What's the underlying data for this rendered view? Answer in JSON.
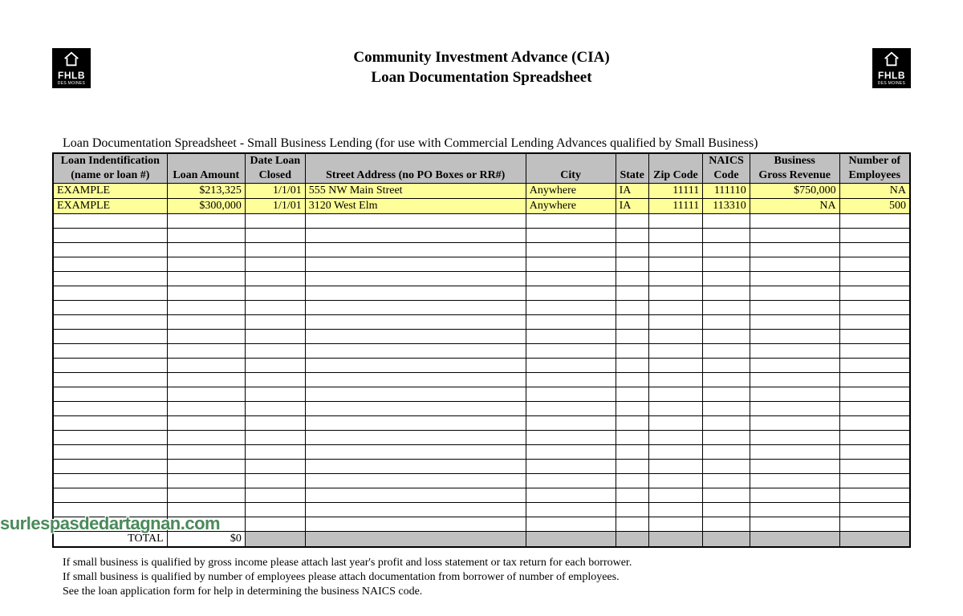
{
  "logo": {
    "line1": "FHLB",
    "line2": "DES MOINES"
  },
  "header": {
    "title1": "Community Investment Advance (CIA)",
    "title2": "Loan Documentation Spreadsheet"
  },
  "subtitle": "Loan Documentation Spreadsheet - Small Business Lending (for use with Commercial Lending Advances qualified by Small Business)",
  "columns": {
    "loan_id_1": "Loan Indentification",
    "loan_id_2": "(name or loan #)",
    "amount": "Loan Amount",
    "date_1": "Date Loan",
    "date_2": "Closed",
    "street": "Street Address (no PO Boxes or RR#)",
    "city": "City",
    "state": "State",
    "zip": "Zip Code",
    "naics_1": "NAICS",
    "naics_2": "Code",
    "revenue_1": "Business",
    "revenue_2": "Gross Revenue",
    "emp_1": "Number of",
    "emp_2": "Employees"
  },
  "rows": [
    {
      "loan_id": "EXAMPLE",
      "amount": "$213,325",
      "date": "1/1/01",
      "street": "555 NW Main Street",
      "city": "Anywhere",
      "state": "IA",
      "zip": "11111",
      "naics": "111110",
      "revenue": "$750,000",
      "emp": "NA"
    },
    {
      "loan_id": "EXAMPLE",
      "amount": "$300,000",
      "date": "1/1/01",
      "street": "3120 West Elm",
      "city": "Anywhere",
      "state": "IA",
      "zip": "11111",
      "naics": "113310",
      "revenue": "NA",
      "emp": "500"
    }
  ],
  "empty_row_count": 22,
  "total": {
    "label": "TOTAL",
    "amount": "$0"
  },
  "footnotes": [
    "If small business is qualified by gross income please attach last year's profit and loss statement or tax return for each borrower.",
    "If small business is qualified by number of employees please attach documentation from borrower of number of employees.",
    "See the loan application form for help in determining the business NAICS code."
  ],
  "watermark": "surlespasdedartagnan.com"
}
